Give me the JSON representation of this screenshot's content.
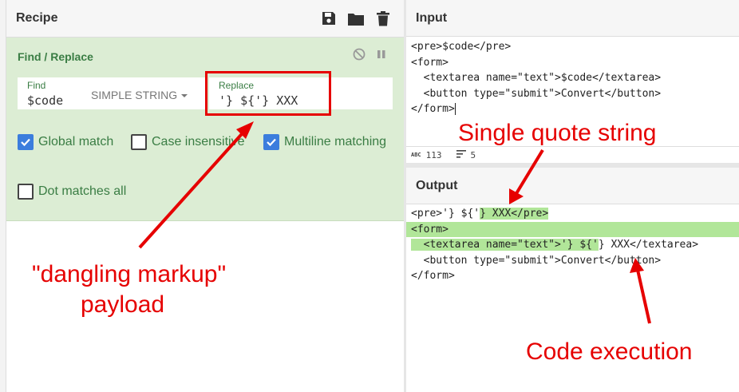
{
  "recipe": {
    "title": "Recipe",
    "icons": [
      "save-icon",
      "folder-icon",
      "trash-icon"
    ],
    "operation": {
      "title": "Find / Replace",
      "controls": [
        "disable-icon",
        "pause-icon"
      ],
      "find": {
        "label": "Find",
        "value": "$code",
        "mode": "SIMPLE STRING"
      },
      "replace": {
        "label": "Replace",
        "value": "'} ${'} XXX"
      },
      "options": [
        {
          "label": "Global match",
          "checked": true
        },
        {
          "label": "Case insensitive",
          "checked": false
        },
        {
          "label": "Multiline matching",
          "checked": true
        },
        {
          "label": "Dot matches all",
          "checked": false
        }
      ]
    }
  },
  "input": {
    "title": "Input",
    "lines": [
      "<pre>$code</pre>",
      "<form>",
      "  <textarea name=\"text\">$code</textarea>",
      "  <button type=\"submit\">Convert</button>",
      "</form>"
    ],
    "status": {
      "abc_label": "ABC",
      "chars": "113",
      "lines_label": "5"
    }
  },
  "output": {
    "title": "Output",
    "line1_plain": "<pre>'} ${'",
    "line1_hl": "} XXX</pre>",
    "line2": "<form>",
    "line3_hl": "  <textarea name=\"text\">'} ${'",
    "line3_plain": "} XXX</textarea>",
    "line4": "  <button type=\"submit\">Convert</button>",
    "line5": "</form>"
  },
  "annotations": {
    "single_quote": "Single quote string",
    "dangling_line1": "\"dangling markup\"",
    "dangling_line2": "payload",
    "code_exec": "Code execution"
  },
  "colors": {
    "accent_red": "#e60000",
    "op_bg": "#dcedd4",
    "op_text": "#3a7d44",
    "check_blue": "#3b7ddd",
    "output_hl": "#b1e699"
  }
}
